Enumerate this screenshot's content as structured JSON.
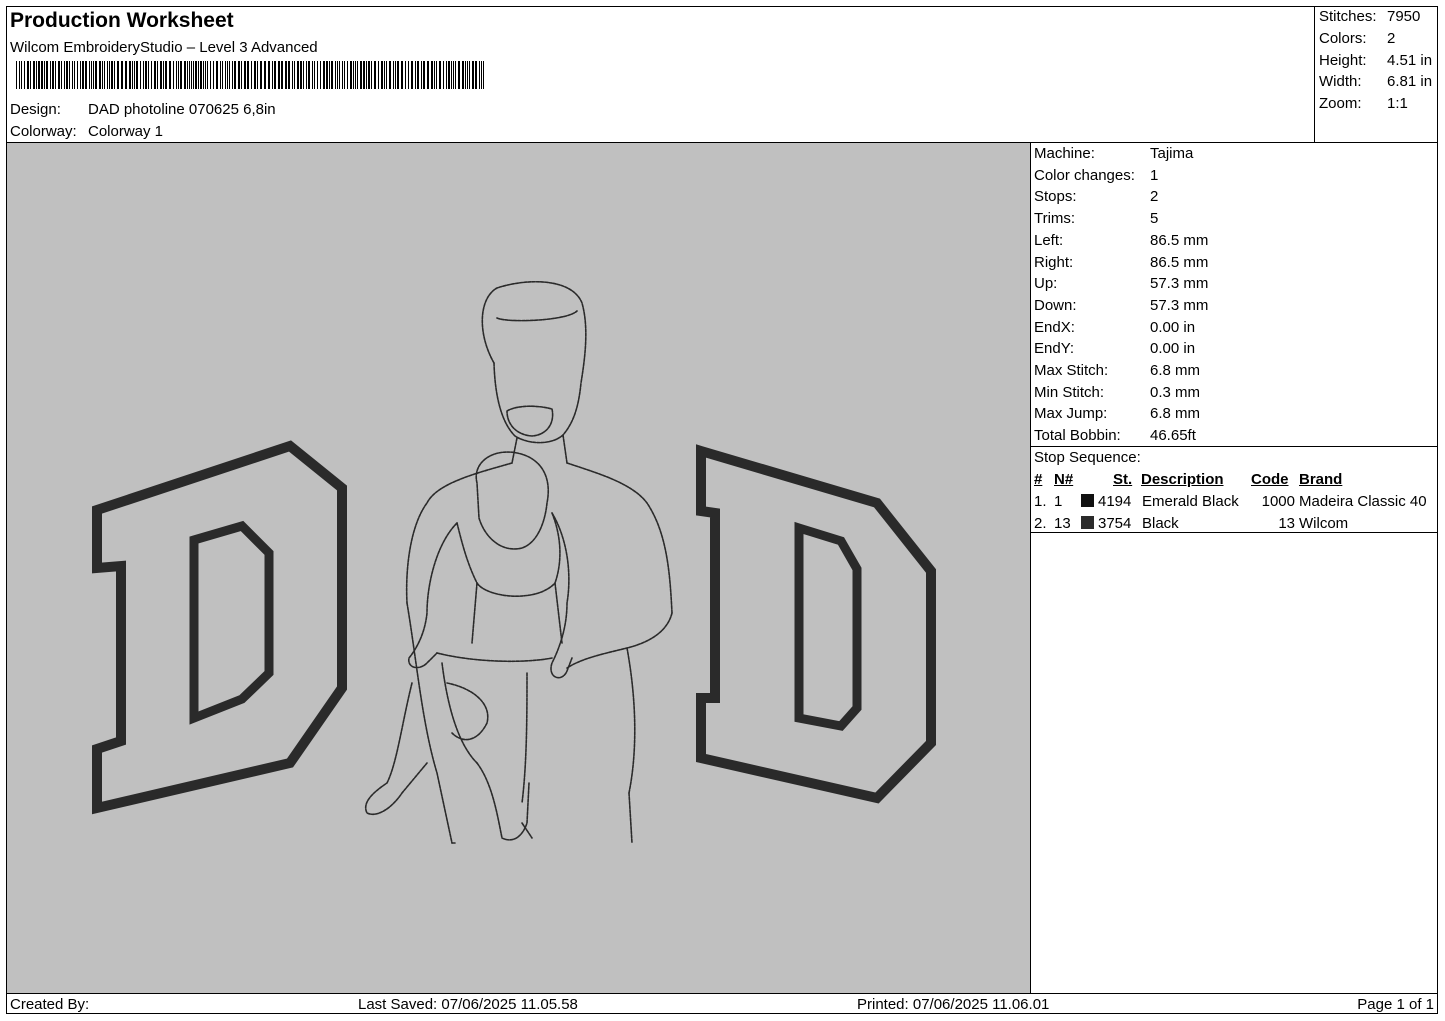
{
  "header": {
    "title": "Production Worksheet",
    "software": "Wilcom EmbroideryStudio – Level 3 Advanced",
    "design_label": "Design:",
    "design_value": "DAD photoline 070625 6,8in",
    "colorway_label": "Colorway:",
    "colorway_value": "Colorway 1"
  },
  "summary": [
    {
      "label": "Stitches:",
      "value": "7950"
    },
    {
      "label": "Colors:",
      "value": "2"
    },
    {
      "label": "Height:",
      "value": "4.51 in"
    },
    {
      "label": "Width:",
      "value": "6.81 in"
    },
    {
      "label": "Zoom:",
      "value": "1:1"
    }
  ],
  "machine": [
    {
      "label": "Machine:",
      "value": "Tajima"
    },
    {
      "label": "Color changes:",
      "value": "1"
    },
    {
      "label": "Stops:",
      "value": "2"
    },
    {
      "label": "Trims:",
      "value": "5"
    },
    {
      "label": "Left:",
      "value": "86.5 mm"
    },
    {
      "label": "Right:",
      "value": "86.5 mm"
    },
    {
      "label": "Up:",
      "value": "57.3 mm"
    },
    {
      "label": "Down:",
      "value": "57.3 mm"
    },
    {
      "label": "EndX:",
      "value": "0.00 in"
    },
    {
      "label": "EndY:",
      "value": "0.00 in"
    },
    {
      "label": "Max Stitch:",
      "value": "6.8 mm"
    },
    {
      "label": "Min Stitch:",
      "value": "0.3 mm"
    },
    {
      "label": "Max Jump:",
      "value": "6.8 mm"
    },
    {
      "label": "Total Bobbin:",
      "value": "46.65ft"
    }
  ],
  "stop_sequence": {
    "title": "Stop Sequence:",
    "headers": {
      "num": "#",
      "needle": "N#",
      "st": "St.",
      "desc": "Description",
      "code": "Code",
      "brand": "Brand"
    },
    "rows": [
      {
        "num": "1.",
        "needle": "1",
        "color": "#111111",
        "st": "4194",
        "desc": "Emerald Black",
        "code": "1000",
        "brand": "Madeira Classic 40"
      },
      {
        "num": "2.",
        "needle": "13",
        "color": "#2b2b2b",
        "st": "3754",
        "desc": "Black",
        "code": "13",
        "brand": "Wilcom"
      }
    ]
  },
  "preview": {
    "background": "#c0c0c0",
    "stitch_color": "#2a2a2a"
  },
  "footer": {
    "created_by": "Created By:",
    "last_saved": "Last Saved: 07/06/2025 11.05.58",
    "printed": "Printed: 07/06/2025 11.06.01",
    "page": "Page 1 of 1"
  }
}
